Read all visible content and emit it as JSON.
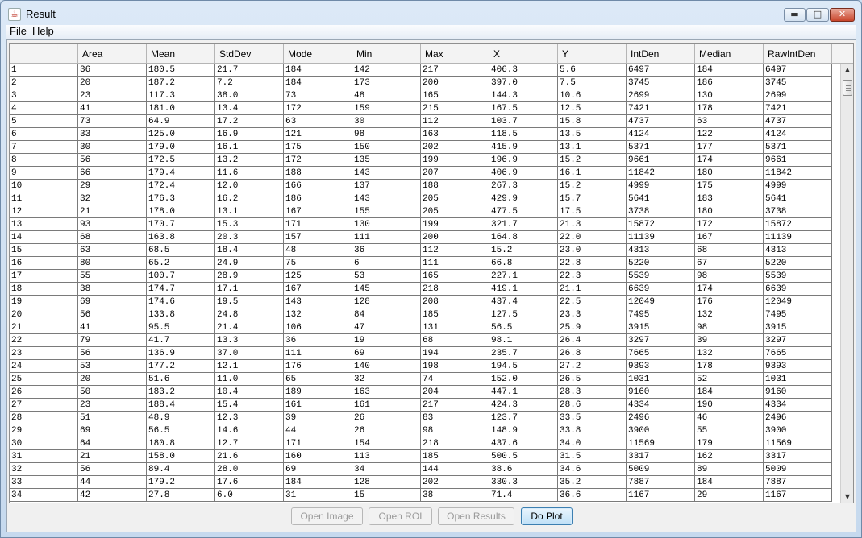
{
  "window": {
    "title": "Result",
    "app_icon": "java-cup-icon",
    "controls": [
      "minimize-icon",
      "maximize-icon",
      "close-icon"
    ]
  },
  "menubar": {
    "items": [
      {
        "label": "File"
      },
      {
        "label": "Help"
      }
    ]
  },
  "table": {
    "columns": [
      "",
      "Area",
      "Mean",
      "StdDev",
      "Mode",
      "Min",
      "Max",
      "X",
      "Y",
      "IntDen",
      "Median",
      "RawIntDen"
    ],
    "rows": [
      [
        "1",
        "36",
        "180.5",
        "21.7",
        "184",
        "142",
        "217",
        "406.3",
        "5.6",
        "6497",
        "184",
        "6497"
      ],
      [
        "2",
        "20",
        "187.2",
        "7.2",
        "184",
        "173",
        "200",
        "397.0",
        "7.5",
        "3745",
        "186",
        "3745"
      ],
      [
        "3",
        "23",
        "117.3",
        "38.0",
        "73",
        "48",
        "165",
        "144.3",
        "10.6",
        "2699",
        "130",
        "2699"
      ],
      [
        "4",
        "41",
        "181.0",
        "13.4",
        "172",
        "159",
        "215",
        "167.5",
        "12.5",
        "7421",
        "178",
        "7421"
      ],
      [
        "5",
        "73",
        "64.9",
        "17.2",
        "63",
        "30",
        "112",
        "103.7",
        "15.8",
        "4737",
        "63",
        "4737"
      ],
      [
        "6",
        "33",
        "125.0",
        "16.9",
        "121",
        "98",
        "163",
        "118.5",
        "13.5",
        "4124",
        "122",
        "4124"
      ],
      [
        "7",
        "30",
        "179.0",
        "16.1",
        "175",
        "150",
        "202",
        "415.9",
        "13.1",
        "5371",
        "177",
        "5371"
      ],
      [
        "8",
        "56",
        "172.5",
        "13.2",
        "172",
        "135",
        "199",
        "196.9",
        "15.2",
        "9661",
        "174",
        "9661"
      ],
      [
        "9",
        "66",
        "179.4",
        "11.6",
        "188",
        "143",
        "207",
        "406.9",
        "16.1",
        "11842",
        "180",
        "11842"
      ],
      [
        "10",
        "29",
        "172.4",
        "12.0",
        "166",
        "137",
        "188",
        "267.3",
        "15.2",
        "4999",
        "175",
        "4999"
      ],
      [
        "11",
        "32",
        "176.3",
        "16.2",
        "186",
        "143",
        "205",
        "429.9",
        "15.7",
        "5641",
        "183",
        "5641"
      ],
      [
        "12",
        "21",
        "178.0",
        "13.1",
        "167",
        "155",
        "205",
        "477.5",
        "17.5",
        "3738",
        "180",
        "3738"
      ],
      [
        "13",
        "93",
        "170.7",
        "15.3",
        "171",
        "130",
        "199",
        "321.7",
        "21.3",
        "15872",
        "172",
        "15872"
      ],
      [
        "14",
        "68",
        "163.8",
        "20.3",
        "157",
        "111",
        "200",
        "164.8",
        "22.0",
        "11139",
        "167",
        "11139"
      ],
      [
        "15",
        "63",
        "68.5",
        "18.4",
        "48",
        "36",
        "112",
        "15.2",
        "23.0",
        "4313",
        "68",
        "4313"
      ],
      [
        "16",
        "80",
        "65.2",
        "24.9",
        "75",
        "6",
        "111",
        "66.8",
        "22.8",
        "5220",
        "67",
        "5220"
      ],
      [
        "17",
        "55",
        "100.7",
        "28.9",
        "125",
        "53",
        "165",
        "227.1",
        "22.3",
        "5539",
        "98",
        "5539"
      ],
      [
        "18",
        "38",
        "174.7",
        "17.1",
        "167",
        "145",
        "218",
        "419.1",
        "21.1",
        "6639",
        "174",
        "6639"
      ],
      [
        "19",
        "69",
        "174.6",
        "19.5",
        "143",
        "128",
        "208",
        "437.4",
        "22.5",
        "12049",
        "176",
        "12049"
      ],
      [
        "20",
        "56",
        "133.8",
        "24.8",
        "132",
        "84",
        "185",
        "127.5",
        "23.3",
        "7495",
        "132",
        "7495"
      ],
      [
        "21",
        "41",
        "95.5",
        "21.4",
        "106",
        "47",
        "131",
        "56.5",
        "25.9",
        "3915",
        "98",
        "3915"
      ],
      [
        "22",
        "79",
        "41.7",
        "13.3",
        "36",
        "19",
        "68",
        "98.1",
        "26.4",
        "3297",
        "39",
        "3297"
      ],
      [
        "23",
        "56",
        "136.9",
        "37.0",
        "111",
        "69",
        "194",
        "235.7",
        "26.8",
        "7665",
        "132",
        "7665"
      ],
      [
        "24",
        "53",
        "177.2",
        "12.1",
        "176",
        "140",
        "198",
        "194.5",
        "27.2",
        "9393",
        "178",
        "9393"
      ],
      [
        "25",
        "20",
        "51.6",
        "11.0",
        "65",
        "32",
        "74",
        "152.0",
        "26.5",
        "1031",
        "52",
        "1031"
      ],
      [
        "26",
        "50",
        "183.2",
        "10.4",
        "189",
        "163",
        "204",
        "447.1",
        "28.3",
        "9160",
        "184",
        "9160"
      ],
      [
        "27",
        "23",
        "188.4",
        "15.4",
        "161",
        "161",
        "217",
        "424.3",
        "28.6",
        "4334",
        "190",
        "4334"
      ],
      [
        "28",
        "51",
        "48.9",
        "12.3",
        "39",
        "26",
        "83",
        "123.7",
        "33.5",
        "2496",
        "46",
        "2496"
      ],
      [
        "29",
        "69",
        "56.5",
        "14.6",
        "44",
        "26",
        "98",
        "148.9",
        "33.8",
        "3900",
        "55",
        "3900"
      ],
      [
        "30",
        "64",
        "180.8",
        "12.7",
        "171",
        "154",
        "218",
        "437.6",
        "34.0",
        "11569",
        "179",
        "11569"
      ],
      [
        "31",
        "21",
        "158.0",
        "21.6",
        "160",
        "113",
        "185",
        "500.5",
        "31.5",
        "3317",
        "162",
        "3317"
      ],
      [
        "32",
        "56",
        "89.4",
        "28.0",
        "69",
        "34",
        "144",
        "38.6",
        "34.6",
        "5009",
        "89",
        "5009"
      ],
      [
        "33",
        "44",
        "179.2",
        "17.6",
        "184",
        "128",
        "202",
        "330.3",
        "35.2",
        "7887",
        "184",
        "7887"
      ],
      [
        "34",
        "42",
        "27.8",
        "6.0",
        "31",
        "15",
        "38",
        "71.4",
        "36.6",
        "1167",
        "29",
        "1167"
      ]
    ]
  },
  "buttons": {
    "open_image": "Open Image",
    "open_roi": "Open ROI",
    "open_results": "Open Results",
    "do_plot": "Do Plot"
  },
  "colors": {
    "title_bar": "#dce9f7",
    "close_button": "#c9442a",
    "focused_button_border": "#3c7fb1",
    "grid_line": "#7a7a7a"
  }
}
